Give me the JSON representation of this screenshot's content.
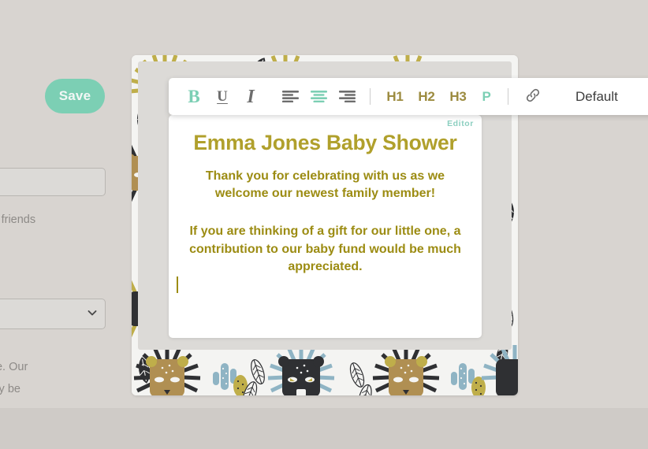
{
  "background": {
    "page_bg": "#d8d4d0",
    "mat_bg": "#dcdad7"
  },
  "left_panel": {
    "save_label": "Save",
    "save_color": "#7ccfb4",
    "text_input_value": "",
    "select_value": "",
    "note_1": "zed. (Your friends",
    "note_2": "P template. Our",
    "note_3": "can't currently be",
    "chevron_icon": "chevron-down-icon"
  },
  "toolbar": {
    "style_name": "Default",
    "accent_color": "#7ccfb4",
    "heading_color": "#9c8b3f",
    "buttons": [
      {
        "id": "bold",
        "label": "B",
        "icon": "bold-icon",
        "active": true
      },
      {
        "id": "underline",
        "label": "U",
        "icon": "underline-icon",
        "active": false
      },
      {
        "id": "italic",
        "label": "I",
        "icon": "italic-icon",
        "active": false
      },
      {
        "id": "align-left",
        "label": "",
        "icon": "align-left-icon",
        "active": false
      },
      {
        "id": "align-center",
        "label": "",
        "icon": "align-center-icon",
        "active": true
      },
      {
        "id": "align-right",
        "label": "",
        "icon": "align-right-icon",
        "active": false
      },
      {
        "id": "h1",
        "label": "H1",
        "icon": "heading-1-icon",
        "active": false
      },
      {
        "id": "h2",
        "label": "H2",
        "icon": "heading-2-icon",
        "active": false
      },
      {
        "id": "h3",
        "label": "H3",
        "icon": "heading-3-icon",
        "active": false
      },
      {
        "id": "paragraph",
        "label": "P",
        "icon": "paragraph-icon",
        "active": true
      },
      {
        "id": "link",
        "label": "",
        "icon": "link-icon",
        "active": false
      }
    ]
  },
  "editor": {
    "badge": "Editor",
    "badge_color": "#8ccfc0",
    "title": "Emma Jones Baby Shower",
    "title_color": "#b0a02c",
    "body_color": "#9c8c13",
    "paragraph_1": "Thank you for celebrating with us as we welcome our newest family member!",
    "paragraph_2": "If you are thinking of a gift for our little one, a contribution to our baby fund would be much appreciated.",
    "caret_visible": true
  },
  "card": {
    "theme": "safari-jungle-lions",
    "pattern_colors": {
      "gold": "#bfae4a",
      "tan": "#b08f52",
      "charcoal": "#2f3033",
      "blue": "#8fb4c4",
      "paper": "#f4f4f2"
    }
  }
}
